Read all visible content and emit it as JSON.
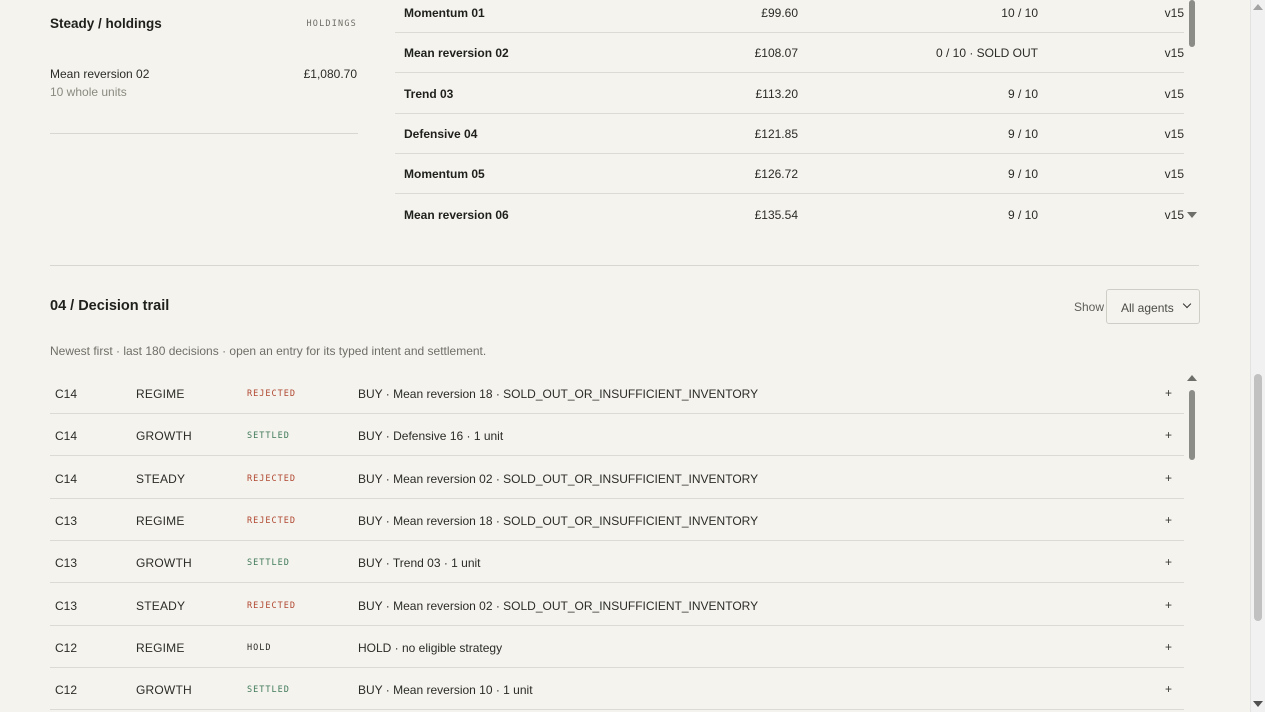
{
  "holdings": {
    "title": "Steady / holdings",
    "tag": "HOLDINGS",
    "items": [
      {
        "name": "Mean reversion 02",
        "units": "10 whole units",
        "value": "£1,080.70"
      }
    ]
  },
  "strategies": [
    {
      "name": "Momentum 01",
      "price": "£99.60",
      "stock": "10 / 10",
      "version": "v15"
    },
    {
      "name": "Mean reversion 02",
      "price": "£108.07",
      "stock": "0 / 10 · SOLD OUT",
      "version": "v15"
    },
    {
      "name": "Trend 03",
      "price": "£113.20",
      "stock": "9 / 10",
      "version": "v15"
    },
    {
      "name": "Defensive 04",
      "price": "£121.85",
      "stock": "9 / 10",
      "version": "v15"
    },
    {
      "name": "Momentum 05",
      "price": "£126.72",
      "stock": "9 / 10",
      "version": "v15"
    },
    {
      "name": "Mean reversion 06",
      "price": "£135.54",
      "stock": "9 / 10",
      "version": "v15"
    }
  ],
  "decision_trail": {
    "title": "04 / Decision trail",
    "show_label": "Show",
    "filter_value": "All agents",
    "subtitle": "Newest first · last 180 decisions · open an entry for its typed intent and settlement.",
    "expand_glyph": "+",
    "status_colors": {
      "REJECTED": "#b0472f",
      "SETTLED": "#3f7a58",
      "HOLD": "#2b2b27"
    },
    "rows": [
      {
        "cycle": "C14",
        "agent": "REGIME",
        "status": "REJECTED",
        "intent": "BUY · Mean reversion 18 · SOLD_OUT_OR_INSUFFICIENT_INVENTORY"
      },
      {
        "cycle": "C14",
        "agent": "GROWTH",
        "status": "SETTLED",
        "intent": "BUY · Defensive 16 · 1 unit"
      },
      {
        "cycle": "C14",
        "agent": "STEADY",
        "status": "REJECTED",
        "intent": "BUY · Mean reversion 02 · SOLD_OUT_OR_INSUFFICIENT_INVENTORY"
      },
      {
        "cycle": "C13",
        "agent": "REGIME",
        "status": "REJECTED",
        "intent": "BUY · Mean reversion 18 · SOLD_OUT_OR_INSUFFICIENT_INVENTORY"
      },
      {
        "cycle": "C13",
        "agent": "GROWTH",
        "status": "SETTLED",
        "intent": "BUY · Trend 03 · 1 unit"
      },
      {
        "cycle": "C13",
        "agent": "STEADY",
        "status": "REJECTED",
        "intent": "BUY · Mean reversion 02 · SOLD_OUT_OR_INSUFFICIENT_INVENTORY"
      },
      {
        "cycle": "C12",
        "agent": "REGIME",
        "status": "HOLD",
        "intent": "HOLD · no eligible strategy"
      },
      {
        "cycle": "C12",
        "agent": "GROWTH",
        "status": "SETTLED",
        "intent": "BUY · Mean reversion 10 · 1 unit"
      }
    ]
  }
}
